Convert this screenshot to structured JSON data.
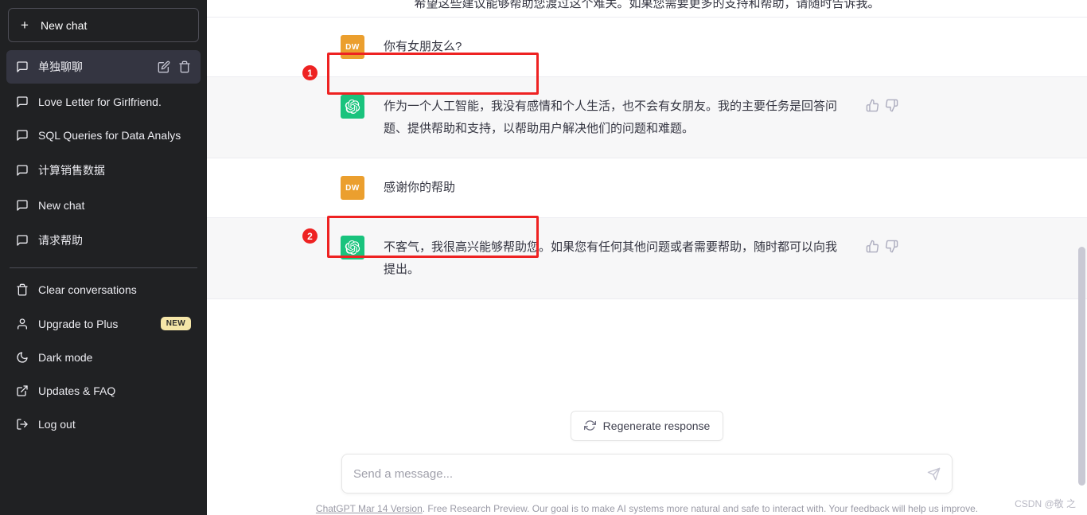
{
  "sidebar": {
    "new_chat": {
      "label": "New chat",
      "icon": "plus-icon"
    },
    "conversations": [
      {
        "label": "单独聊聊",
        "active": true,
        "icon": "chat-bubble-icon",
        "actions": [
          "pencil-icon",
          "trash-icon"
        ]
      },
      {
        "label": "Love Letter for Girlfriend.",
        "active": false,
        "icon": "chat-bubble-icon"
      },
      {
        "label": "SQL Queries for Data Analys",
        "active": false,
        "icon": "chat-bubble-icon"
      },
      {
        "label": "计算销售数据",
        "active": false,
        "icon": "chat-bubble-icon"
      },
      {
        "label": "New chat",
        "active": false,
        "icon": "chat-bubble-icon"
      },
      {
        "label": "请求帮助",
        "active": false,
        "icon": "chat-bubble-icon"
      }
    ],
    "menu": [
      {
        "label": "Clear conversations",
        "icon": "trash-icon"
      },
      {
        "label": "Upgrade to Plus",
        "icon": "user-icon",
        "badge": "NEW"
      },
      {
        "label": "Dark mode",
        "icon": "moon-icon"
      },
      {
        "label": "Updates & FAQ",
        "icon": "external-link-icon"
      },
      {
        "label": "Log out",
        "icon": "logout-icon"
      }
    ]
  },
  "thread": {
    "cutoff_text": "希望这些建议能够帮助您渡过这个难关。如果您需要更多的支持和帮助，请随时告诉我。",
    "messages": [
      {
        "role": "user",
        "avatar_initials": "DW",
        "text": "你有女朋友么?",
        "annotation_number": "1",
        "highlighted": true
      },
      {
        "role": "assistant",
        "text": "作为一个人工智能，我没有感情和个人生活，也不会有女朋友。我的主要任务是回答问题、提供帮助和支持，以帮助用户解决他们的问题和难题。",
        "actions": [
          "thumbs-up-icon",
          "thumbs-down-icon"
        ]
      },
      {
        "role": "user",
        "avatar_initials": "DW",
        "text": "感谢你的帮助",
        "annotation_number": "2",
        "highlighted": true
      },
      {
        "role": "assistant",
        "text": "不客气，我很高兴能够帮助您。如果您有任何其他问题或者需要帮助，随时都可以向我提出。",
        "actions": [
          "thumbs-up-icon",
          "thumbs-down-icon"
        ]
      }
    ]
  },
  "composer": {
    "regenerate_label": "Regenerate response",
    "regenerate_icon": "refresh-icon",
    "input_value": "",
    "input_placeholder": "Send a message...",
    "send_icon": "send-icon"
  },
  "footer": {
    "link_label": "ChatGPT Mar 14 Version",
    "note": ". Free Research Preview. Our goal is to make AI systems more natural and safe to interact with. Your feedback will help us improve."
  },
  "watermark": "CSDN @敬 之",
  "colors": {
    "sidebar_bg": "#202123",
    "sidebar_active": "#343541",
    "user_avatar": "#eb9f2e",
    "bot_avatar": "#19c37d",
    "assistant_row_bg": "#f7f7f8",
    "annotation_red": "#ee2222",
    "badge_new_bg": "#f5e6a8"
  }
}
